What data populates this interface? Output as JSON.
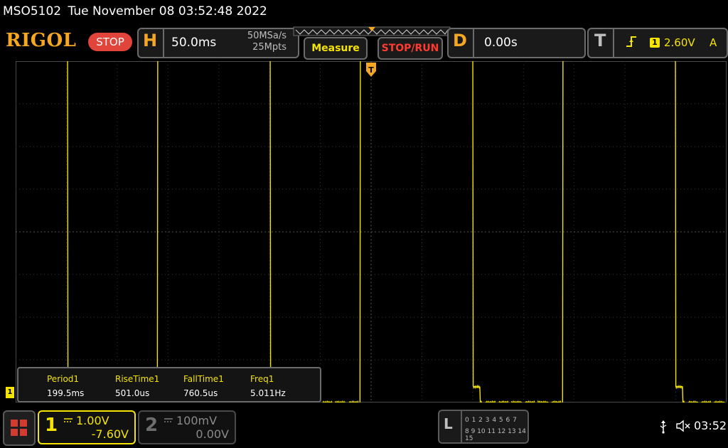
{
  "title_bar": {
    "model": "MSO5102",
    "datetime": "Tue November 08 03:52:48 2022"
  },
  "toolbar": {
    "brand": "RIGOL",
    "status": "STOP",
    "horizontal": {
      "letter": "H",
      "timebase": "50.0ms",
      "sample_rate": "50MSa/s",
      "mem_depth": "25Mpts"
    },
    "measure_label": "Measure",
    "stoprun_label": "STOP/RUN",
    "delay": {
      "letter": "D",
      "value": "0.00s"
    },
    "trigger": {
      "letter": "T",
      "edge_icon": "rising-edge-icon",
      "source": "1",
      "level": "2.60V",
      "mode": "A"
    }
  },
  "waveform": {
    "channel": "1",
    "color": "#f5e400",
    "high_level_v": 2.6,
    "low_level_v": -7.6,
    "period_ms": 199.5,
    "trigger_marker": "T"
  },
  "measurements": {
    "headers": [
      "Period1",
      "RiseTime1",
      "FallTime1",
      "Freq1"
    ],
    "values": [
      "199.5ms",
      "501.0us",
      "760.5us",
      "5.011Hz"
    ]
  },
  "channel_marker": "1",
  "bottom": {
    "ch1": {
      "num": "1",
      "scale": "1.00V",
      "offset": "-7.60V",
      "color": "#f5e400"
    },
    "ch2": {
      "num": "2",
      "scale": "100mV",
      "offset": "0.00V"
    },
    "logic": {
      "letter": "L",
      "row1": "0 1 2 3  4 5 6 7",
      "row2": "8 9 10 11 12 13 14 15"
    },
    "clock": "03:52"
  }
}
